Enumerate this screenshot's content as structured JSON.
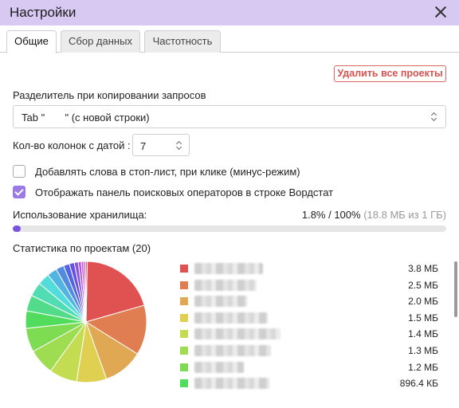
{
  "window": {
    "title": "Настройки"
  },
  "tabs": [
    {
      "label": "Общие",
      "active": true
    },
    {
      "label": "Сбор данных",
      "active": false
    },
    {
      "label": "Частотность",
      "active": false
    }
  ],
  "delete_button": {
    "label": "Удалить все проекты"
  },
  "separator": {
    "label": "Разделитель при копировании запросов",
    "selected": "Tab \"       \" (с новой строки)"
  },
  "date_columns": {
    "label": "Кол-во колонок с датой :",
    "value": "7"
  },
  "checkboxes": [
    {
      "label": "Добавлять слова в стоп-лист, при клике (минус-режим)",
      "checked": false
    },
    {
      "label": "Отображать панель поисковых операторов в строке Вордстат",
      "checked": true
    }
  ],
  "storage": {
    "label": "Использование хранилища:",
    "percent_text": "1.8% / 100%",
    "detail_text": "(18.8 МБ из 1 ГБ)",
    "used_fraction": 0.018,
    "fill_color": "#7b53e0"
  },
  "stats": {
    "label": "Статистика по проектам (20)"
  },
  "chart_data": {
    "type": "pie",
    "title": "",
    "slices": [
      {
        "value": 3.8,
        "unit": "MB",
        "color": "#e05252"
      },
      {
        "value": 2.5,
        "unit": "MB",
        "color": "#e07e52"
      },
      {
        "value": 2.0,
        "unit": "MB",
        "color": "#e0a852"
      },
      {
        "value": 1.5,
        "unit": "MB",
        "color": "#e0d052"
      },
      {
        "value": 1.4,
        "unit": "MB",
        "color": "#c4dc52"
      },
      {
        "value": 1.3,
        "unit": "MB",
        "color": "#9edc52"
      },
      {
        "value": 1.2,
        "unit": "MB",
        "color": "#7ddc52"
      },
      {
        "value": 0.8754,
        "unit": "MB",
        "color": "#52dc5e"
      },
      {
        "value": 0.8,
        "color": "#52dc8a"
      },
      {
        "value": 0.7,
        "color": "#52dcb4"
      },
      {
        "value": 0.6,
        "color": "#52dcdc"
      },
      {
        "value": 0.5,
        "color": "#52b4e0"
      },
      {
        "value": 0.4,
        "color": "#528ae0"
      },
      {
        "value": 0.3,
        "color": "#5264e0"
      },
      {
        "value": 0.25,
        "color": "#6a52e0"
      },
      {
        "value": 0.2,
        "color": "#8a52e0"
      },
      {
        "value": 0.15,
        "color": "#ae52e0"
      },
      {
        "value": 0.12,
        "color": "#d052e0"
      },
      {
        "value": 0.1,
        "color": "#e052b8"
      },
      {
        "value": 0.08,
        "color": "#e05288"
      }
    ]
  },
  "legend": [
    {
      "size": "3.8 МБ",
      "color": "#e05252"
    },
    {
      "size": "2.5 МБ",
      "color": "#e07e52"
    },
    {
      "size": "2.0 МБ",
      "color": "#e0a852"
    },
    {
      "size": "1.5 МБ",
      "color": "#e0d052"
    },
    {
      "size": "1.4 МБ",
      "color": "#c4dc52"
    },
    {
      "size": "1.3 МБ",
      "color": "#9edc52"
    },
    {
      "size": "1.2 МБ",
      "color": "#7ddc52"
    },
    {
      "size": "896.4 КБ",
      "color": "#52dc5e"
    }
  ]
}
